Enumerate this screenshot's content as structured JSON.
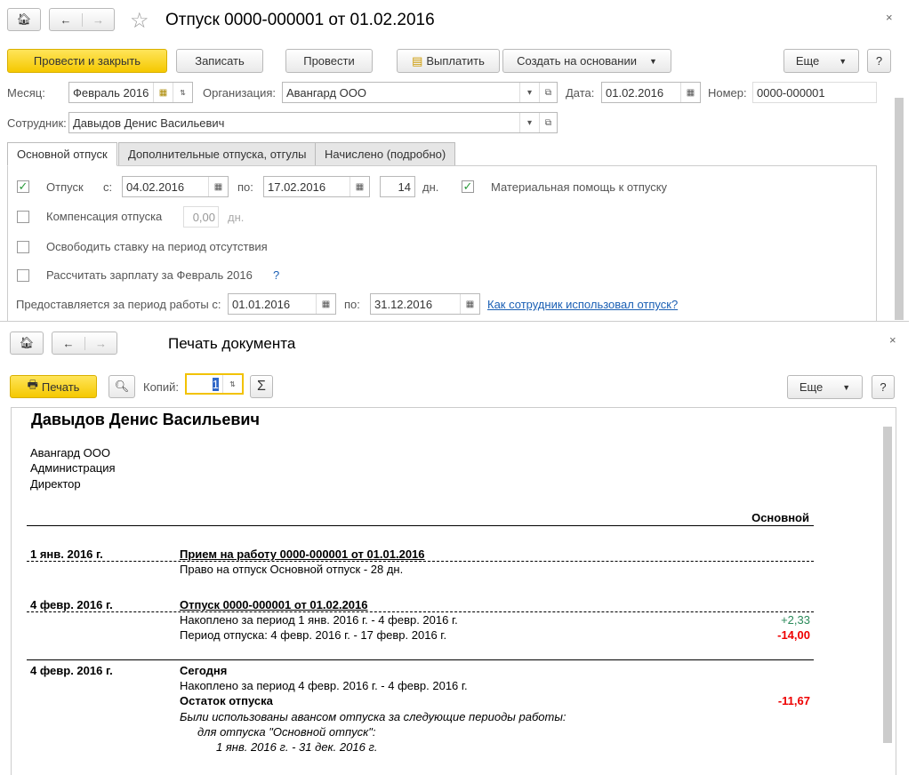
{
  "doc": {
    "title": "Отпуск 0000-000001 от 01.02.2016",
    "toolbar": {
      "post_close": "Провести и закрыть",
      "save": "Записать",
      "post": "Провести",
      "pay": "Выплатить",
      "create_based": "Создать на основании",
      "more": "Еще",
      "help": "?"
    },
    "month_label": "Месяц:",
    "month": "Февраль 2016",
    "org_label": "Организация:",
    "org": "Авангард ООО",
    "date_label": "Дата:",
    "date": "01.02.2016",
    "num_label": "Номер:",
    "num": "0000-000001",
    "emp_label": "Сотрудник:",
    "emp": "Давыдов Денис Васильевич",
    "tabs": [
      "Основной отпуск",
      "Дополнительные отпуска, отгулы",
      "Начислено (подробно)"
    ],
    "vacation_label": "Отпуск",
    "from_label": "с:",
    "from": "04.02.2016",
    "to_label": "по:",
    "to": "17.02.2016",
    "days": "14",
    "days_unit": "дн.",
    "aid_label": "Материальная помощь к отпуску",
    "comp_label": "Компенсация отпуска",
    "comp_value": "0,00",
    "comp_unit": "дн.",
    "free_rate_label": "Освободить ставку на период отсутствия",
    "calc_salary_label": "Рассчитать зарплату за Февраль 2016",
    "calc_help": "?",
    "period_label": "Предоставляется за период работы с:",
    "period_from": "01.01.2016",
    "period_to_label": "по:",
    "period_to": "31.12.2016",
    "usage_link": "Как сотрудник использовал отпуск?"
  },
  "print": {
    "title": "Печать документа",
    "print_btn": "Печать",
    "copies_label": "Копий:",
    "copies": "1",
    "more": "Еще",
    "help": "?",
    "report": {
      "name": "Давыдов Денис Васильевич",
      "org_lines": [
        "Авангард ООО",
        "Администрация",
        "Директор"
      ],
      "column": "Основной",
      "entries": [
        {
          "date": "1 янв. 2016 г.",
          "title": "Прием на работу 0000-000001 от 01.01.2016",
          "lines": [
            {
              "text": "Право на отпуск Основной отпуск - 28 дн.",
              "value": ""
            }
          ]
        },
        {
          "date": "4 февр. 2016 г.",
          "title": "Отпуск 0000-000001 от 01.02.2016",
          "lines": [
            {
              "text": "Накоплено за период 1 янв. 2016 г. - 4 февр. 2016 г.",
              "value": "+2,33"
            },
            {
              "text": "Период отпуска: 4 февр. 2016 г. - 17 февр. 2016 г.",
              "value": "-14,00"
            }
          ]
        }
      ],
      "today": {
        "date": "4 февр. 2016 г.",
        "title": "Сегодня",
        "accrued": "Накоплено за период 4 февр. 2016 г. - 4 февр. 2016 г.",
        "balance_label": "Остаток отпуска",
        "balance": "-11,67",
        "note1": "Были использованы авансом отпуска за следующие периоды работы:",
        "note2": "для отпуска \"Основной отпуск\":",
        "note3": "1 янв. 2016 г. - 31 дек. 2016 г."
      }
    }
  }
}
